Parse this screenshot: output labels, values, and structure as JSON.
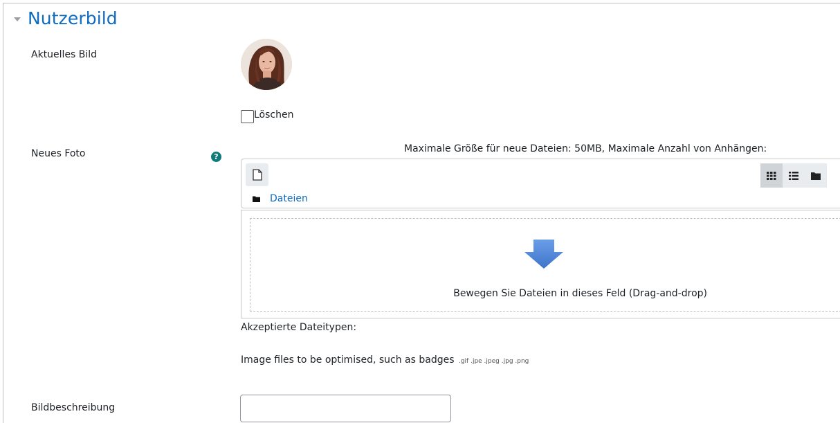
{
  "section": {
    "title": "Nutzerbild"
  },
  "current_image": {
    "label": "Aktuelles Bild",
    "delete_label": "Löschen"
  },
  "new_photo": {
    "label": "Neues Foto",
    "help_icon": "question-circle-icon",
    "max_size_text": "Maximale Größe für neue Dateien: 50MB, Maximale Anzahl von Anhängen:",
    "filepicker": {
      "add_icon": "file-icon",
      "views": [
        "grid-icon",
        "list-icon",
        "folder-icon"
      ],
      "path_label": "Dateien"
    },
    "dropzone_text": "Bewegen Sie Dateien in dieses Feld (Drag-and-drop)"
  },
  "accepted": {
    "label": "Akzeptierte Dateitypen:",
    "description": "Image files to be optimised, such as badges",
    "extensions": ".gif .jpe .jpeg .jpg .png"
  },
  "image_description": {
    "label": "Bildbeschreibung",
    "value": ""
  },
  "colors": {
    "link": "#0f6cbf",
    "help": "#0f7a7a",
    "arrow": "#4d88d6"
  }
}
